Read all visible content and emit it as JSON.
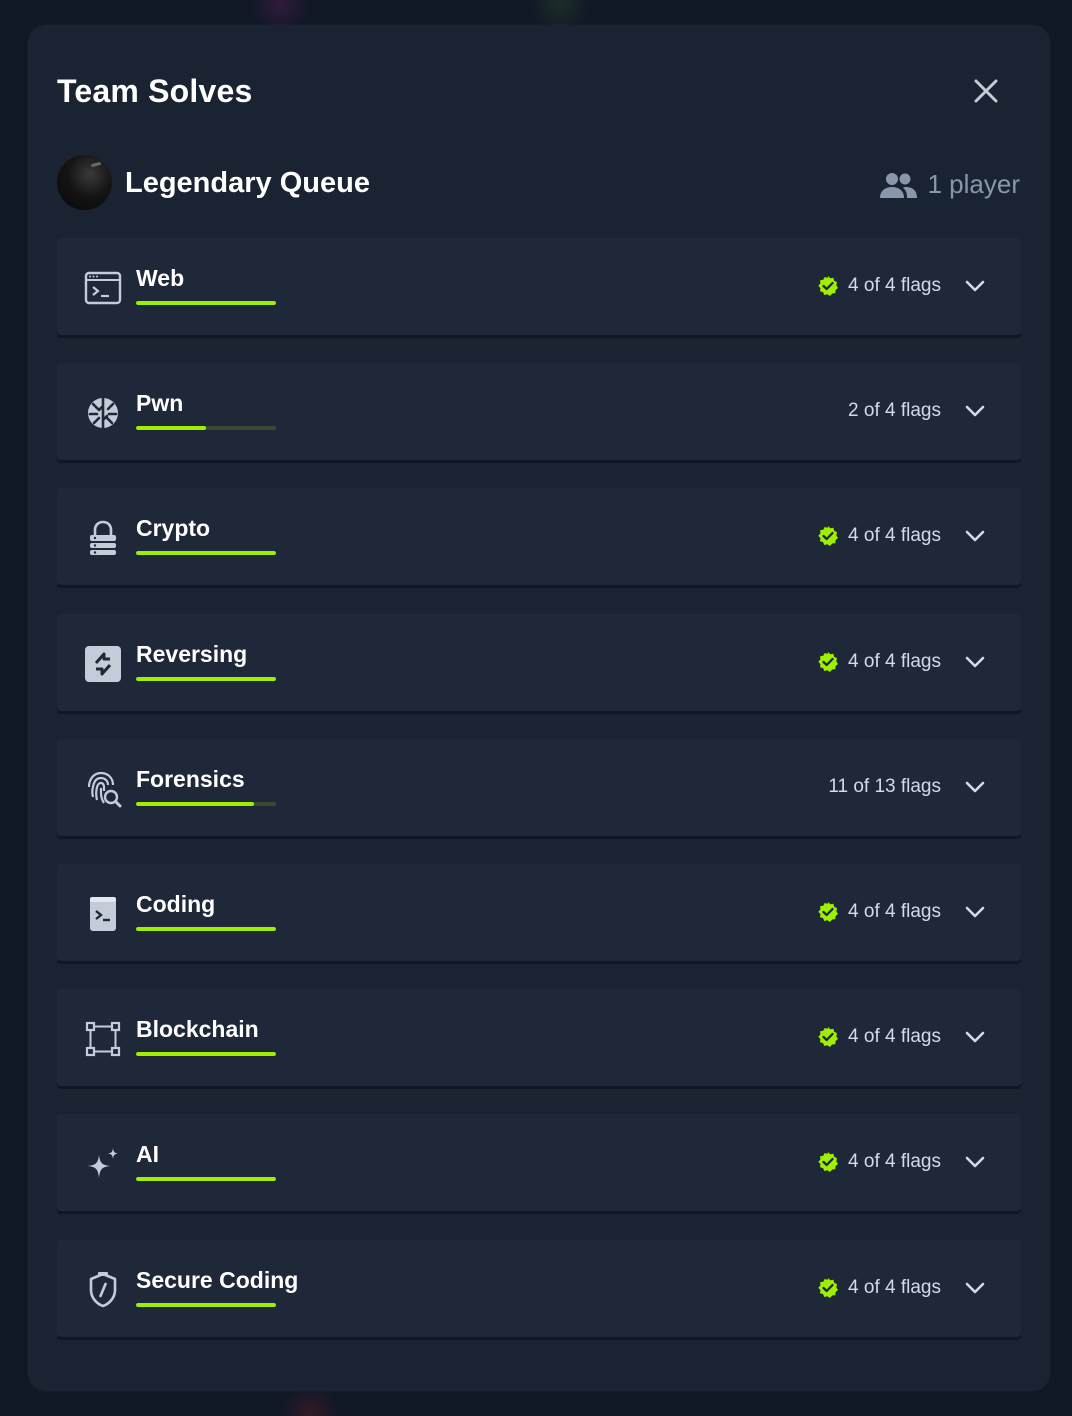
{
  "modal": {
    "title": "Team Solves"
  },
  "team": {
    "name": "Legendary Queue",
    "players_label": "1 player"
  },
  "colors": {
    "accent": "#9fef00",
    "panel": "#1a2332",
    "row": "#1e2838",
    "muted": "#8a96ac"
  },
  "categories": [
    {
      "name": "Web",
      "icon": "terminal-window-icon",
      "flags_text": "4 of 4 flags",
      "solved": 4,
      "total": 4,
      "complete": true
    },
    {
      "name": "Pwn",
      "icon": "brain-icon",
      "flags_text": "2 of 4 flags",
      "solved": 2,
      "total": 4,
      "complete": false
    },
    {
      "name": "Crypto",
      "icon": "lock-icon",
      "flags_text": "4 of 4 flags",
      "solved": 4,
      "total": 4,
      "complete": true
    },
    {
      "name": "Reversing",
      "icon": "reverse-arrows-icon",
      "flags_text": "4 of 4 flags",
      "solved": 4,
      "total": 4,
      "complete": true
    },
    {
      "name": "Forensics",
      "icon": "fingerprint-search-icon",
      "flags_text": "11 of 13 flags",
      "solved": 11,
      "total": 13,
      "complete": false
    },
    {
      "name": "Coding",
      "icon": "code-file-icon",
      "flags_text": "4 of 4 flags",
      "solved": 4,
      "total": 4,
      "complete": true
    },
    {
      "name": "Blockchain",
      "icon": "blockchain-nodes-icon",
      "flags_text": "4 of 4 flags",
      "solved": 4,
      "total": 4,
      "complete": true
    },
    {
      "name": "AI",
      "icon": "sparkles-icon",
      "flags_text": "4 of 4 flags",
      "solved": 4,
      "total": 4,
      "complete": true
    },
    {
      "name": "Secure Coding",
      "icon": "shield-slash-icon",
      "flags_text": "4 of 4 flags",
      "solved": 4,
      "total": 4,
      "complete": true
    }
  ]
}
